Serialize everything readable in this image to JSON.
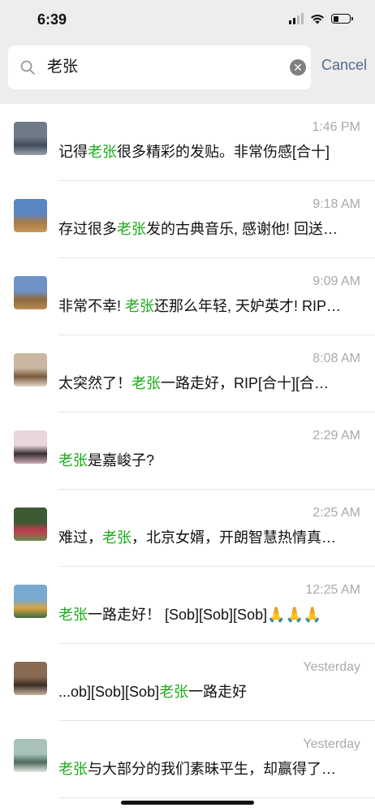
{
  "status_bar": {
    "time": "6:39"
  },
  "search": {
    "query": "老张",
    "cancel_label": "Cancel"
  },
  "results": [
    {
      "name": "",
      "time": "1:46 PM",
      "before": "记得",
      "keyword": "老张",
      "after": "很多精彩的发贴。非常伤感[合十]",
      "avatar_colors": [
        "#6e7a86",
        "#3f4c5a",
        "#99a3ad"
      ]
    },
    {
      "name": "",
      "time": "9:18 AM",
      "before": "存过很多",
      "keyword": "老张",
      "after": "发的古典音乐, 感谢他! 回送…",
      "avatar_colors": [
        "#5a86c4",
        "#a77b48",
        "#c59a5a"
      ]
    },
    {
      "name": "",
      "time": "9:09 AM",
      "before": "非常不幸! ",
      "keyword": "老张",
      "after": "还那么年轻, 天妒英才! RIP…",
      "avatar_colors": [
        "#6f92c6",
        "#8e6a3e",
        "#b88b4f"
      ]
    },
    {
      "name": "",
      "time": "8:08 AM",
      "before": "太突然了！",
      "keyword": "老张",
      "after": "一路走好，RIP[合十][合…",
      "avatar_colors": [
        "#c9b7a1",
        "#7a5a3c",
        "#e3d7c7"
      ]
    },
    {
      "name": "",
      "time": "2:29 AM",
      "before": "",
      "keyword": "老张",
      "after": "是嘉峻子?",
      "avatar_colors": [
        "#e8d6dc",
        "#3a2f35",
        "#c9aab6"
      ]
    },
    {
      "name": "",
      "time": "2:25 AM",
      "before": "难过，",
      "keyword": "老张",
      "after": "，北京女婿，开朗智慧热情真…",
      "avatar_colors": [
        "#3e5a34",
        "#c23a4e",
        "#6c8a4f"
      ]
    },
    {
      "name": "",
      "time": "12:25 AM",
      "before": "",
      "keyword": "老张",
      "after": "一路走好！ [Sob][Sob][Sob]🙏🙏🙏",
      "avatar_colors": [
        "#78a9d0",
        "#d9a441",
        "#3c6a3c"
      ]
    },
    {
      "name": "",
      "time": "Yesterday",
      "before": "...ob][Sob][Sob]",
      "keyword": "老张",
      "after": "一路走好",
      "avatar_colors": [
        "#8a6a52",
        "#3c2e24",
        "#c7b49e"
      ]
    },
    {
      "name": "",
      "time": "Yesterday",
      "before": "",
      "keyword": "老张",
      "after": "与大部分的我们素昧平生，却赢得了…",
      "avatar_colors": [
        "#a9c2b8",
        "#4d6a5e",
        "#e6e9e4"
      ]
    }
  ]
}
